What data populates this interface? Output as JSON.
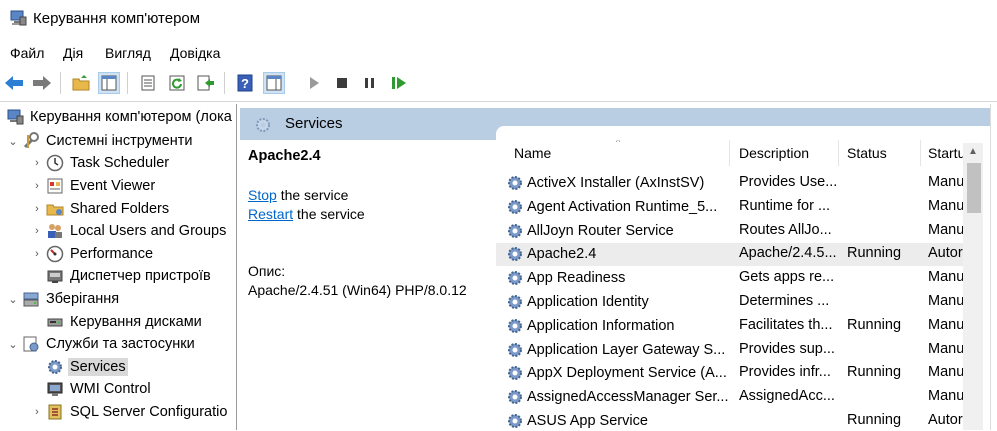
{
  "window": {
    "title": "Керування комп'ютером"
  },
  "menu": [
    "Файл",
    "Дія",
    "Вигляд",
    "Довідка"
  ],
  "tree": [
    {
      "label": "Керування комп'ютером (лока",
      "level": 0,
      "icon": "computer-management-icon",
      "exp": ""
    },
    {
      "label": "Системні інструменти",
      "level": 1,
      "icon": "system-tools-icon",
      "exp": "⌄"
    },
    {
      "label": "Task Scheduler",
      "level": 2,
      "icon": "clock-icon",
      "exp": "›"
    },
    {
      "label": "Event Viewer",
      "level": 2,
      "icon": "event-viewer-icon",
      "exp": "›"
    },
    {
      "label": "Shared Folders",
      "level": 2,
      "icon": "shared-folder-icon",
      "exp": "›"
    },
    {
      "label": "Local Users and Groups",
      "level": 2,
      "icon": "users-icon",
      "exp": "›"
    },
    {
      "label": "Performance",
      "level": 2,
      "icon": "performance-icon",
      "exp": "›"
    },
    {
      "label": "Диспетчер пристроїв",
      "level": 2,
      "icon": "device-manager-icon",
      "exp": ""
    },
    {
      "label": "Зберігання",
      "level": 1,
      "icon": "storage-icon",
      "exp": "⌄"
    },
    {
      "label": "Керування дисками",
      "level": 2,
      "icon": "disk-icon",
      "exp": ""
    },
    {
      "label": "Служби та застосунки",
      "level": 1,
      "icon": "services-apps-icon",
      "exp": "⌄"
    },
    {
      "label": "Services",
      "level": 2,
      "icon": "services-gear-icon",
      "exp": "",
      "selected": true
    },
    {
      "label": "WMI Control",
      "level": 2,
      "icon": "wmi-icon",
      "exp": ""
    },
    {
      "label": "SQL Server Configuratio",
      "level": 2,
      "icon": "sql-icon",
      "exp": "›"
    }
  ],
  "panel": {
    "header": "Services",
    "selected_service": "Apache2.4",
    "stop_link": "Stop",
    "stop_rest": " the service",
    "restart_link": "Restart",
    "restart_rest": " the service",
    "desc_label": "Опис:",
    "desc_text": "Apache/2.4.51 (Win64) PHP/8.0.12"
  },
  "columns": [
    "Name",
    "Description",
    "Status",
    "Startu"
  ],
  "services": [
    {
      "name": "ActiveX Installer (AxInstSV)",
      "desc": "Provides Use...",
      "status": "",
      "startup": "Manu"
    },
    {
      "name": "Agent Activation Runtime_5...",
      "desc": "Runtime for ...",
      "status": "",
      "startup": "Manu"
    },
    {
      "name": "AllJoyn Router Service",
      "desc": "Routes AllJo...",
      "status": "",
      "startup": "Manu"
    },
    {
      "name": "Apache2.4",
      "desc": "Apache/2.4.5...",
      "status": "Running",
      "startup": "Autor",
      "selected": true
    },
    {
      "name": "App Readiness",
      "desc": "Gets apps re...",
      "status": "",
      "startup": "Manu"
    },
    {
      "name": "Application Identity",
      "desc": "Determines ...",
      "status": "",
      "startup": "Manu"
    },
    {
      "name": "Application Information",
      "desc": "Facilitates th...",
      "status": "Running",
      "startup": "Manu"
    },
    {
      "name": "Application Layer Gateway S...",
      "desc": "Provides sup...",
      "status": "",
      "startup": "Manu"
    },
    {
      "name": "AppX Deployment Service (A...",
      "desc": "Provides infr...",
      "status": "Running",
      "startup": "Manu"
    },
    {
      "name": "AssignedAccessManager Ser...",
      "desc": "AssignedAcc...",
      "status": "",
      "startup": "Manu"
    },
    {
      "name": "ASUS App Service",
      "desc": "",
      "status": "Running",
      "startup": "Autor"
    }
  ]
}
